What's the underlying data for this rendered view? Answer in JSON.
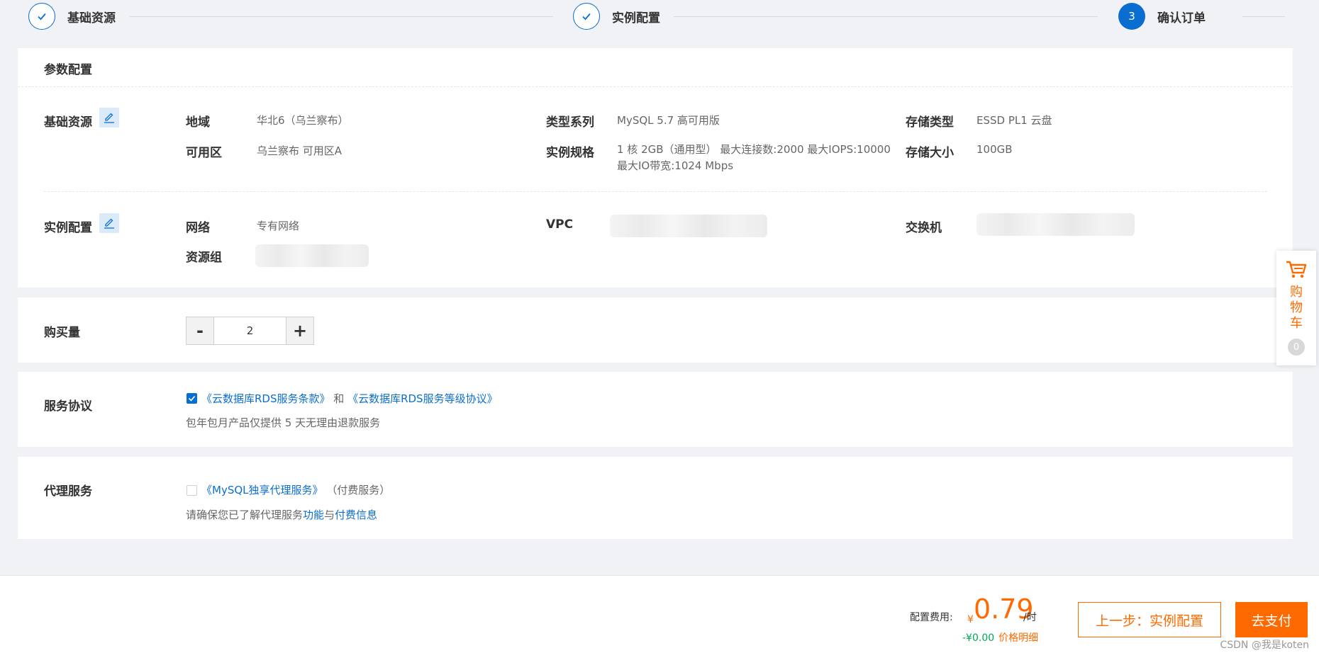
{
  "steps": [
    {
      "label": "基础资源",
      "state": "done"
    },
    {
      "label": "实例配置",
      "state": "done"
    },
    {
      "label": "确认订单",
      "state": "active",
      "number": "3"
    }
  ],
  "config": {
    "title": "参数配置",
    "basic": {
      "title": "基础资源",
      "region_label": "地域",
      "region_value": "华北6（乌兰察布）",
      "series_label": "类型系列",
      "series_value": "MySQL  5.7 高可用版",
      "storage_type_label": "存储类型",
      "storage_type_value": "ESSD PL1 云盘",
      "zone_label": "可用区",
      "zone_value": "乌兰察布 可用区A",
      "spec_label": "实例规格",
      "spec_value": "1 核 2GB（通用型）   最大连接数:2000 最大IOPS:10000 最大IO带宽:1024 Mbps",
      "storage_size_label": "存储大小",
      "storage_size_value": "100GB"
    },
    "instance": {
      "title": "实例配置",
      "network_label": "网络",
      "network_value": "专有网络",
      "vpc_label": "VPC",
      "switch_label": "交换机",
      "resource_group_label": "资源组"
    }
  },
  "quantity": {
    "label": "购买量",
    "minus": "-",
    "value": "2",
    "plus": "+"
  },
  "agreement": {
    "label": "服务协议",
    "link1": "《云数据库RDS服务条款》",
    "conj": "和",
    "link2": "《云数据库RDS服务等级协议》",
    "note": "包年包月产品仅提供 5 天无理由退款服务",
    "checked": true
  },
  "proxy": {
    "label": "代理服务",
    "link": "《MySQL独享代理服务》",
    "paid_note": "（付费服务）",
    "note_prefix": "请确保您已了解代理服务",
    "link_feature": "功能",
    "note_and": "与",
    "link_fee": "付费信息",
    "checked": false
  },
  "cart": {
    "label": "购物车",
    "count": "0",
    "icon": "cart-icon"
  },
  "footer": {
    "fee_label": "配置费用:",
    "currency": "¥",
    "amount": "0.79",
    "unit": "/时",
    "discount": "-¥0.00",
    "price_detail": "价格明细",
    "prev_button": "上一步：实例配置",
    "pay_button": "去支付"
  },
  "watermark": "CSDN @我是koten",
  "colors": {
    "accent": "#0a6ed1",
    "orange": "#ff6a00",
    "green": "#00a854"
  }
}
